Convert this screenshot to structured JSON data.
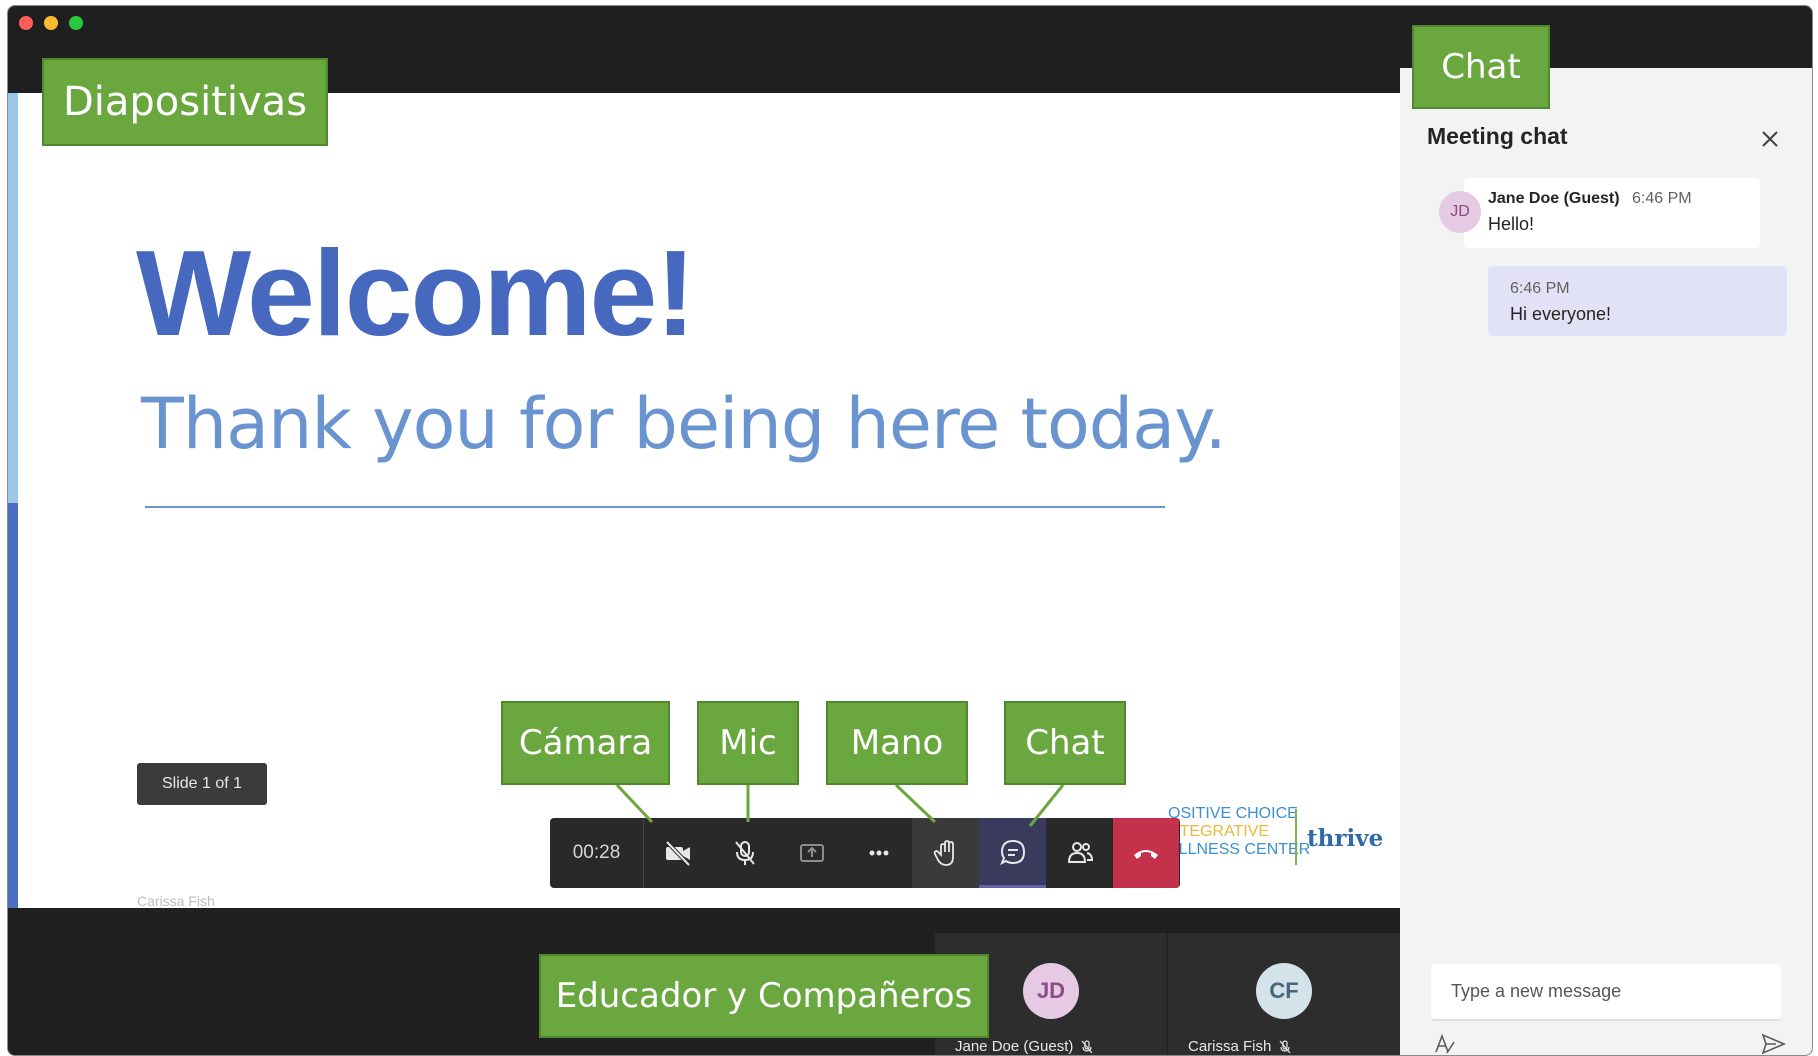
{
  "window": {
    "traffic_lights": [
      "close",
      "minimize",
      "zoom"
    ]
  },
  "slide": {
    "title": "Welcome!",
    "subtitle": "Thank you for being here today.",
    "counter": "Slide 1 of 1",
    "presenter": "Carissa Fish",
    "logo": {
      "line1": "OSITIVE CHOICE",
      "line2": "NTEGRATIVE",
      "line3": "ELLNESS CENTER",
      "brand": "thrive"
    }
  },
  "toolbar": {
    "timer": "00:28",
    "buttons": [
      {
        "name": "camera-off",
        "icon": "video-off-icon"
      },
      {
        "name": "mic-muted",
        "icon": "mic-off-icon"
      },
      {
        "name": "share",
        "icon": "share-screen-icon"
      },
      {
        "name": "more",
        "icon": "more-icon"
      },
      {
        "name": "raise-hand",
        "icon": "hand-icon"
      },
      {
        "name": "chat",
        "icon": "chat-icon",
        "active": true
      },
      {
        "name": "participants",
        "icon": "people-icon"
      },
      {
        "name": "hang-up",
        "icon": "phone-hangup-icon"
      }
    ],
    "colors": {
      "bar": "#292929",
      "active": "#3a3a5c",
      "hangup": "#c4314b"
    }
  },
  "gallery": {
    "participants": [
      {
        "initials": "JD",
        "name": "Jane Doe (Guest)",
        "muted": true
      },
      {
        "initials": "CF",
        "name": "Carissa Fish",
        "muted": true
      }
    ]
  },
  "chat": {
    "title": "Meeting chat",
    "messages": [
      {
        "initials": "JD",
        "sender": "Jane Doe (Guest)",
        "time": "6:46 PM",
        "text": "Hello!",
        "own": false
      },
      {
        "time": "6:46 PM",
        "text": "Hi everyone!",
        "own": true
      }
    ],
    "compose_placeholder": "Type a new message",
    "colors": {
      "own_bubble": "#e2e2f7",
      "panel": "#f3f3f3"
    }
  },
  "callouts": {
    "slides": "Diapositivas",
    "chat_panel": "Chat",
    "camera": "Cámara",
    "mic": "Mic",
    "hand": "Mano",
    "chat_button": "Chat",
    "gallery": "Educador y Compañeros",
    "color": "#6aa83f"
  }
}
